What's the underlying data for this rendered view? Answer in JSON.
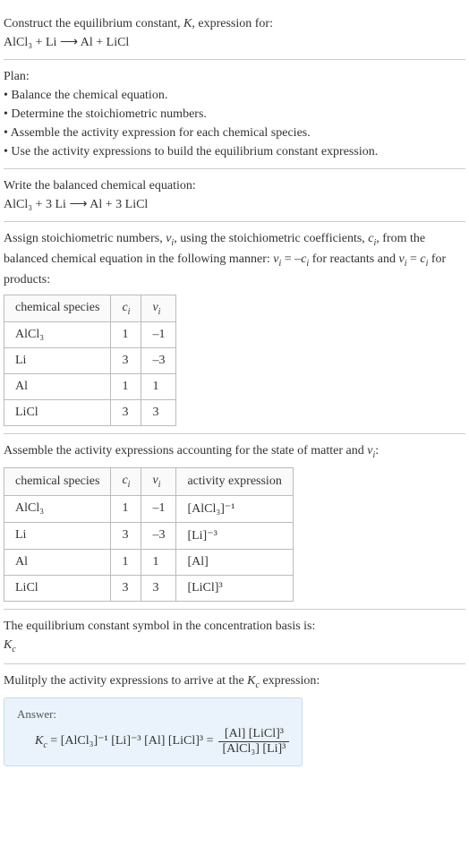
{
  "header": {
    "prompt": "Construct the equilibrium constant, K, expression for:",
    "equation": "AlCl₃ + Li ⟶ Al + LiCl"
  },
  "plan": {
    "title": "Plan:",
    "b1": "• Balance the chemical equation.",
    "b2": "• Determine the stoichiometric numbers.",
    "b3": "• Assemble the activity expression for each chemical species.",
    "b4": "• Use the activity expressions to build the equilibrium constant expression."
  },
  "balanced": {
    "title": "Write the balanced chemical equation:",
    "equation": "AlCl₃ + 3 Li ⟶ Al + 3 LiCl"
  },
  "stoich": {
    "intro": "Assign stoichiometric numbers, νᵢ, using the stoichiometric coefficients, cᵢ, from the balanced chemical equation in the following manner: νᵢ = –cᵢ for reactants and νᵢ = cᵢ for products:",
    "head_species": "chemical species",
    "head_ci": "cᵢ",
    "head_vi": "νᵢ",
    "r1": {
      "s": "AlCl₃",
      "c": "1",
      "v": "–1"
    },
    "r2": {
      "s": "Li",
      "c": "3",
      "v": "–3"
    },
    "r3": {
      "s": "Al",
      "c": "1",
      "v": "1"
    },
    "r4": {
      "s": "LiCl",
      "c": "3",
      "v": "3"
    }
  },
  "activity": {
    "intro": "Assemble the activity expressions accounting for the state of matter and νᵢ:",
    "head_species": "chemical species",
    "head_ci": "cᵢ",
    "head_vi": "νᵢ",
    "head_expr": "activity expression",
    "r1": {
      "s": "AlCl₃",
      "c": "1",
      "v": "–1",
      "e": "[AlCl₃]⁻¹"
    },
    "r2": {
      "s": "Li",
      "c": "3",
      "v": "–3",
      "e": "[Li]⁻³"
    },
    "r3": {
      "s": "Al",
      "c": "1",
      "v": "1",
      "e": "[Al]"
    },
    "r4": {
      "s": "LiCl",
      "c": "3",
      "v": "3",
      "e": "[LiCl]³"
    }
  },
  "symbol": {
    "text": "The equilibrium constant symbol in the concentration basis is:",
    "kc": "K𝒸"
  },
  "final": {
    "text": "Mulitply the activity expressions to arrive at the K𝒸 expression:",
    "answer_label": "Answer:",
    "lhs": "K𝒸 = [AlCl₃]⁻¹ [Li]⁻³ [Al] [LiCl]³ =",
    "num": "[Al] [LiCl]³",
    "den": "[AlCl₃] [Li]³"
  }
}
